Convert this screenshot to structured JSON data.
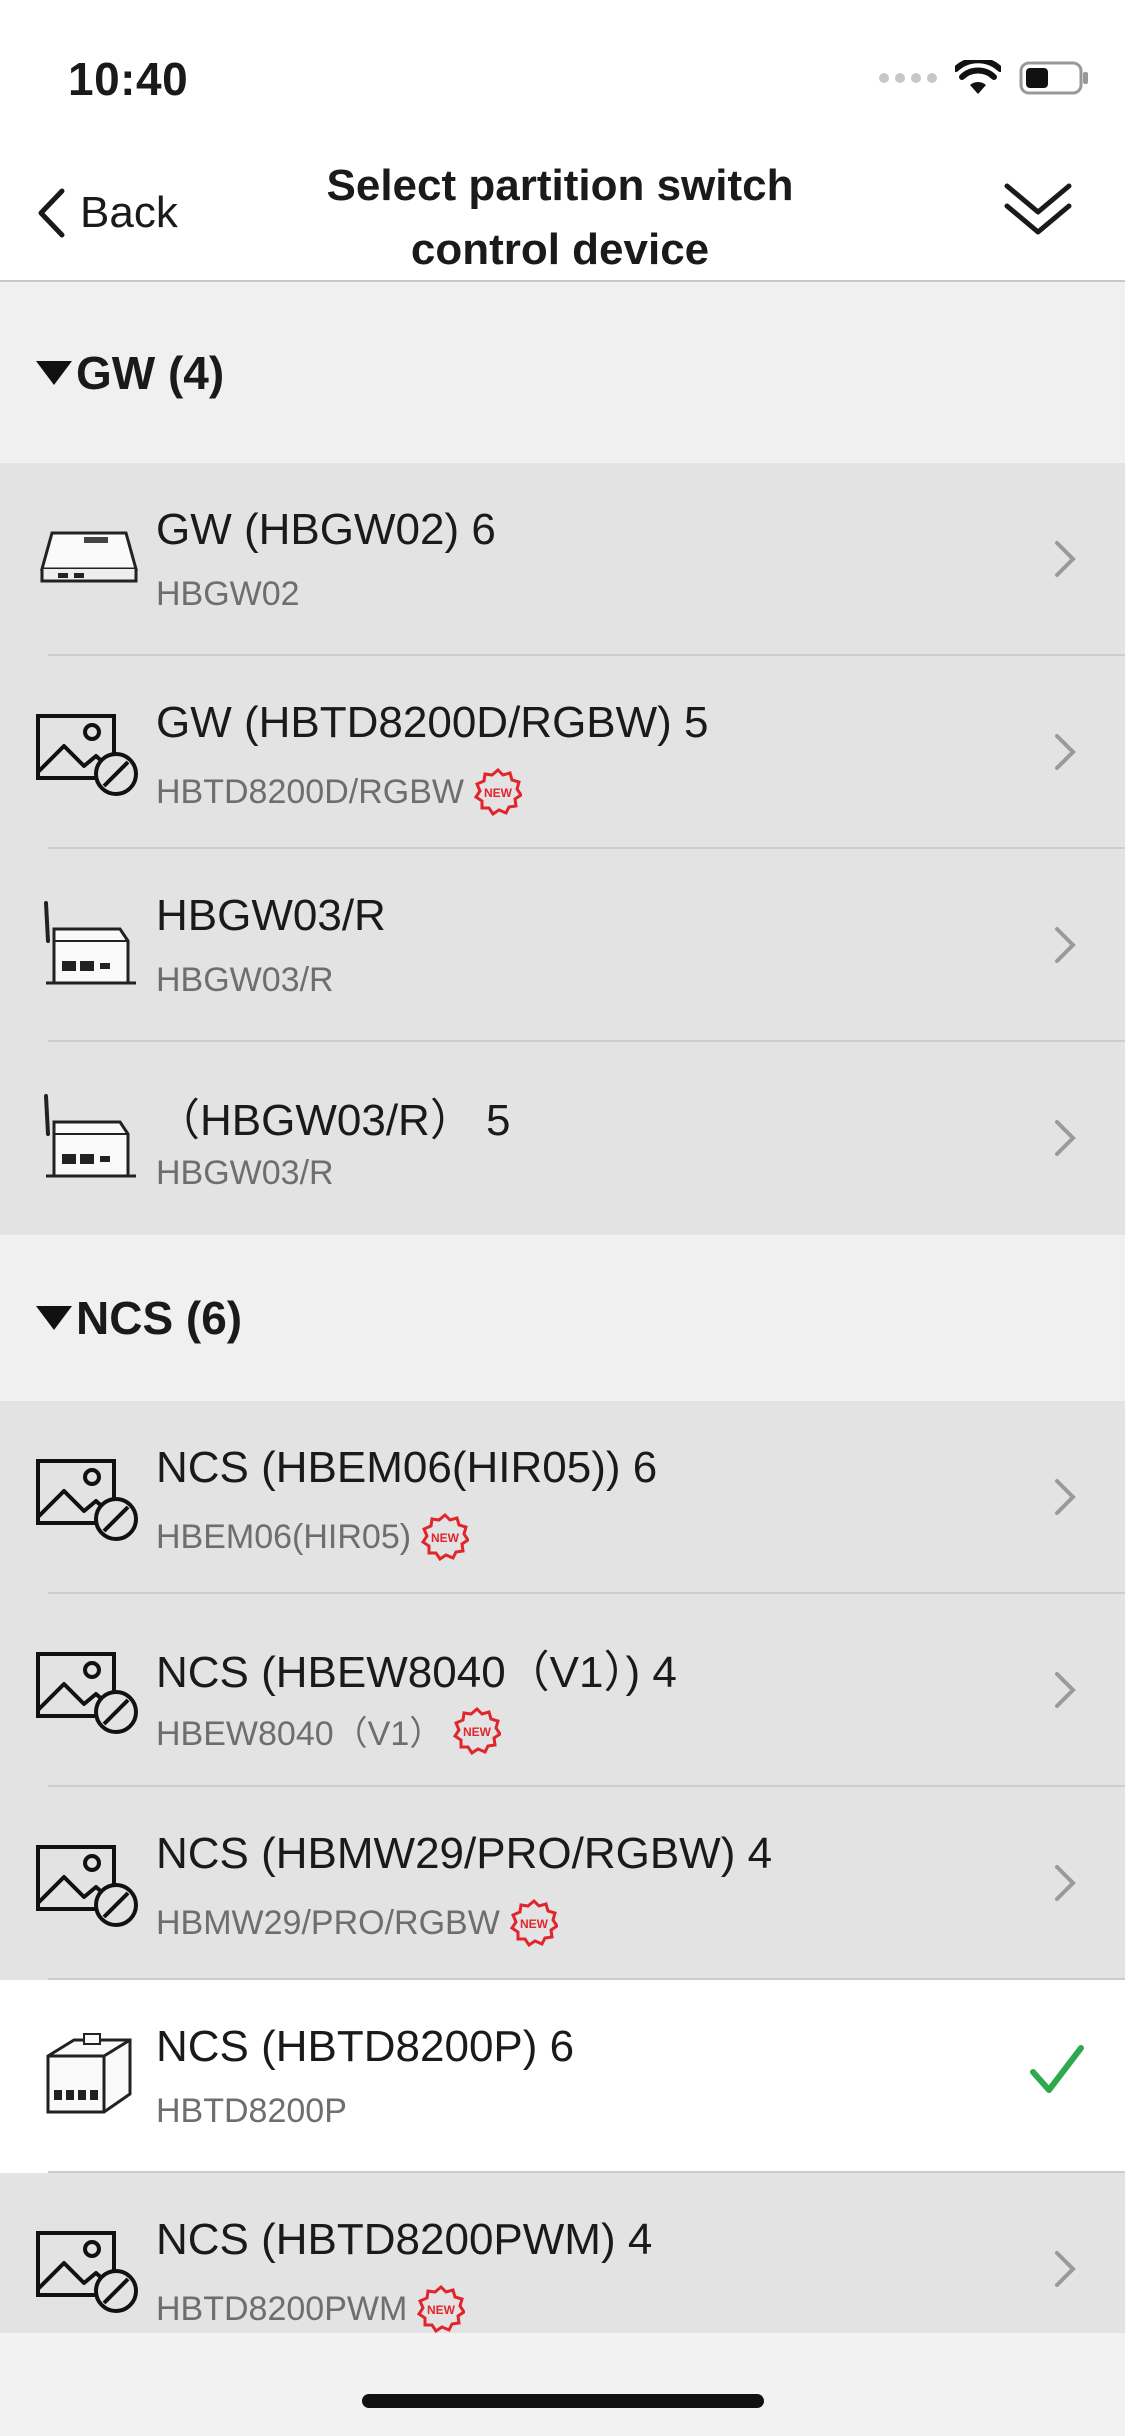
{
  "status": {
    "time": "10:40"
  },
  "nav": {
    "back_label": "Back",
    "title_line1": "Select partition switch",
    "title_line2": "control device"
  },
  "sections": [
    {
      "title": "GW (4)",
      "rows": [
        {
          "name": "GW (HBGW02) 6",
          "model": "HBGW02",
          "is_new": false,
          "icon": "gateway-box-icon",
          "selected": false
        },
        {
          "name": "GW (HBTD8200D/RGBW) 5",
          "model": "HBTD8200D/RGBW",
          "is_new": true,
          "icon": "no-image-icon",
          "selected": false
        },
        {
          "name": "HBGW03/R",
          "model": "HBGW03/R",
          "is_new": false,
          "icon": "antenna-gateway-icon",
          "selected": false
        },
        {
          "name": "（HBGW03/R） 5",
          "model": "HBGW03/R",
          "is_new": false,
          "icon": "antenna-gateway-icon",
          "selected": false
        }
      ]
    },
    {
      "title": "NCS (6)",
      "rows": [
        {
          "name": "NCS (HBEM06(HIR05)) 6",
          "model": "HBEM06(HIR05)",
          "is_new": true,
          "icon": "no-image-icon",
          "selected": false
        },
        {
          "name": "NCS (HBEW8040（V1）) 4",
          "model": "HBEW8040（V1）",
          "is_new": true,
          "icon": "no-image-icon",
          "selected": false
        },
        {
          "name": "NCS (HBMW29/PRO/RGBW) 4",
          "model": "HBMW29/PRO/RGBW",
          "is_new": true,
          "icon": "no-image-icon",
          "selected": false
        },
        {
          "name": "NCS (HBTD8200P) 6",
          "model": "HBTD8200P",
          "is_new": false,
          "icon": "module-device-icon",
          "selected": true
        },
        {
          "name": "NCS (HBTD8200PWM) 4",
          "model": "HBTD8200PWM",
          "is_new": true,
          "icon": "no-image-icon",
          "selected": false
        }
      ]
    }
  ],
  "badge_text": "NEW",
  "colors": {
    "accent_check": "#2fa84f",
    "new_badge": "#e0262c",
    "row_bg": "#e3e3e3",
    "selected_bg": "#ffffff",
    "section_bg": "#f0f0f0"
  }
}
